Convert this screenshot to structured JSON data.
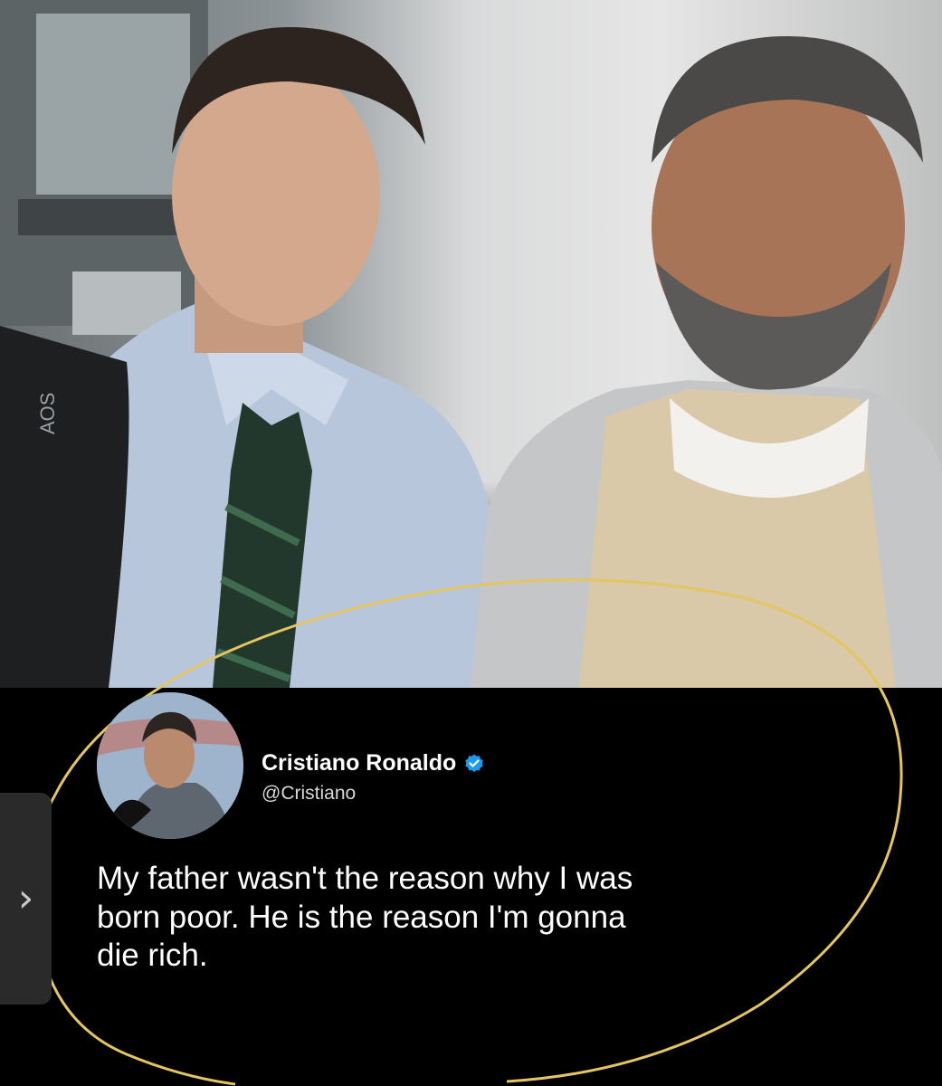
{
  "post": {
    "author_name": "Cristiano Ronaldo",
    "author_handle": "@Cristiano",
    "verified": true,
    "tweet_text": "My father wasn't the reason why I was\nborn poor. He is the reason I'm gonna\ndie rich."
  },
  "photo": {
    "bag_text": "AOS"
  },
  "overlay": {
    "highlight_color": "#e3c561"
  },
  "viewer": {
    "next_icon": "chevron-right-icon",
    "next_glyph": "›"
  }
}
